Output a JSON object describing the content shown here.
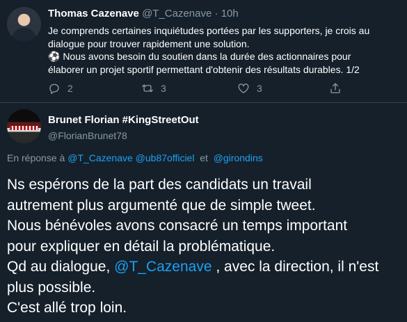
{
  "tweet1": {
    "display_name": "Thomas Cazenave",
    "handle": "@T_Cazenave",
    "separator": "·",
    "time": "10h",
    "lines": [
      "Je comprends certaines inquiétudes portées par les supporters, je crois au",
      "dialogue pour trouver rapidement une solution.",
      "⚽ Nous avons besoin du soutien dans la durée des actionnaires pour",
      "élaborer un projet sportif permettant d'obtenir des résultats durables. 1/2"
    ],
    "reply_count": "2",
    "retweet_count": "3",
    "like_count": "3",
    "icons": [
      "reply-icon",
      "retweet-icon",
      "like-icon",
      "share-icon"
    ]
  },
  "tweet2": {
    "display_name": "Brunet Florian #KingStreetOut",
    "handle": "@FlorianBrunet78",
    "reply_prefix": "En réponse à",
    "reply_mention_1": "@T_Cazenave",
    "reply_mention_2": "@ub87officiel",
    "reply_and": "et",
    "reply_mention_3": "@girondins",
    "body": {
      "line1": "Ns espérons de la part des candidats un travail",
      "line2": "autrement plus argumenté que de simple tweet.",
      "line3": "Nous bénévoles avons consacré un temps important",
      "line4": "pour expliquer en détail la problématique.",
      "line5_before": "Qd au dialogue, ",
      "line5_mention": "@T_Cazenave",
      "line5_after": " , avec la direction, il n'est",
      "line6": "plus possible.",
      "line7": "C'est allé trop loin."
    }
  },
  "colors": {
    "background": "#15202b",
    "text": "#ffffff",
    "muted": "#8899a6",
    "link": "#1da1f2",
    "divider": "#38444d"
  }
}
